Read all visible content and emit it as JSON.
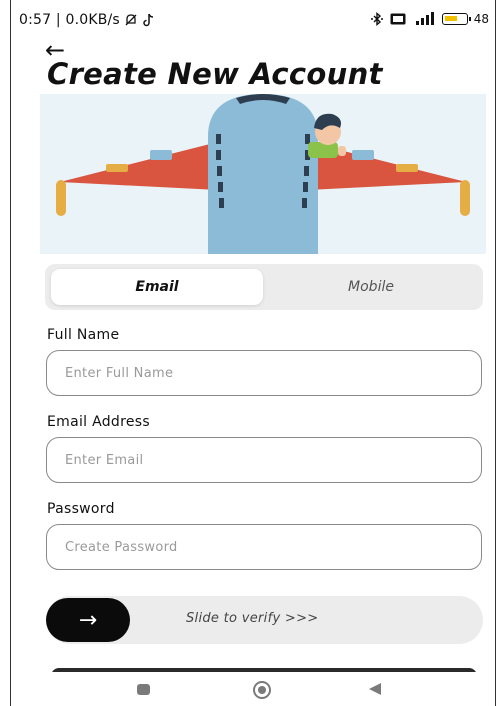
{
  "status_bar": {
    "time_and_speed": "0:57 | 0.0KB/s",
    "battery": "48"
  },
  "header": {
    "back_glyph": "←",
    "title": "Create New Account"
  },
  "tabs": [
    {
      "label": "Email",
      "selected": true
    },
    {
      "label": "Mobile",
      "selected": false
    }
  ],
  "form": {
    "full_name": {
      "label": "Full Name",
      "placeholder": "Enter Full Name",
      "value": ""
    },
    "email": {
      "label": "Email Address",
      "placeholder": "Enter Email",
      "value": ""
    },
    "password": {
      "label": "Password",
      "placeholder": "Create Password",
      "value": ""
    }
  },
  "slider": {
    "handle_glyph": "→",
    "text": "Slide to verify >>>"
  },
  "colors": {
    "accent": "#0b0b0b",
    "hero_background": "#eaf3f7",
    "plane_body": "#8bbbd6",
    "plane_wings": "#d9553f"
  },
  "icons": {
    "back": "back-arrow-icon",
    "slider": "arrow-right-icon",
    "nav_recents": "square-icon",
    "nav_home": "circle-icon",
    "nav_back": "triangle-back-icon"
  }
}
